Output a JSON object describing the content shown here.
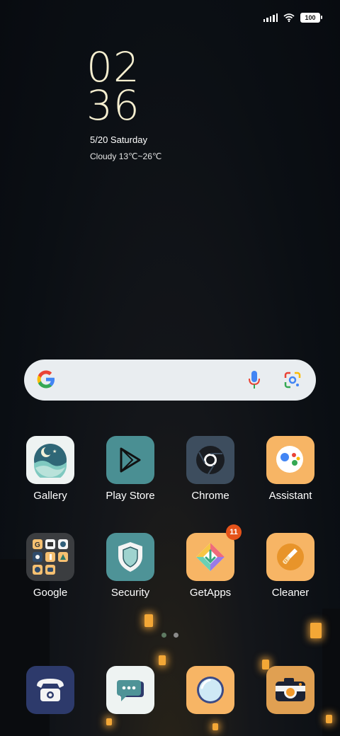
{
  "status_bar": {
    "battery": "100"
  },
  "lock_clock": {
    "hour": "02",
    "minute": "36",
    "date": "5/20 Saturday",
    "weather": "Cloudy 13℃~26℃"
  },
  "search_bar": {
    "icons": [
      "google-logo-icon",
      "microphone-icon",
      "google-lens-icon"
    ]
  },
  "apps_row1": [
    {
      "label": "Gallery",
      "icon": "gallery-icon"
    },
    {
      "label": "Play Store",
      "icon": "play-store-icon"
    },
    {
      "label": "Chrome",
      "icon": "chrome-icon"
    },
    {
      "label": "Assistant",
      "icon": "assistant-icon"
    }
  ],
  "apps_row2": [
    {
      "label": "Google",
      "icon": "google-folder-icon"
    },
    {
      "label": "Security",
      "icon": "security-shield-icon"
    },
    {
      "label": "GetApps",
      "icon": "getapps-icon",
      "badge": "11"
    },
    {
      "label": "Cleaner",
      "icon": "cleaner-brush-icon"
    }
  ],
  "dock": [
    {
      "icon": "phone-icon"
    },
    {
      "icon": "messages-icon"
    },
    {
      "icon": "browser-icon"
    },
    {
      "icon": "camera-icon"
    }
  ],
  "page_indicator": {
    "pages": 2,
    "current": 1
  },
  "colors": {
    "clock": "#f6efd0",
    "badge": "#e5531a",
    "search_bg": "#e9edf0"
  }
}
